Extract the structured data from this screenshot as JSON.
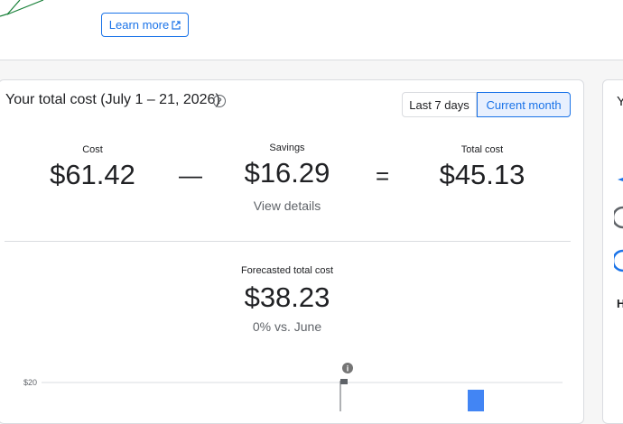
{
  "banner": {
    "learn_more_label": "Learn more"
  },
  "card": {
    "title": "Your total cost (July 1 – 21, 2026)",
    "range_toggle": {
      "options": [
        "Last 7 days",
        "Current month"
      ],
      "selected": "Current month"
    },
    "cost": {
      "label": "Cost",
      "value": "$61.42"
    },
    "minus": "—",
    "savings": {
      "label": "Savings",
      "value": "$16.29",
      "link": "View details"
    },
    "equals": "=",
    "total": {
      "label": "Total cost",
      "value": "$45.13"
    },
    "forecast": {
      "label": "Forecasted total cost",
      "value": "$38.23",
      "comparison": "0% vs. June"
    }
  },
  "chart_data": {
    "type": "bar",
    "yticks": [
      "$20"
    ],
    "marker": "i"
  },
  "side_card": {
    "title_initial": "Y",
    "heading_initial": "H"
  },
  "colors": {
    "accent": "#1a73e8",
    "bar": "#4285f4",
    "marker": "#5f6368"
  }
}
